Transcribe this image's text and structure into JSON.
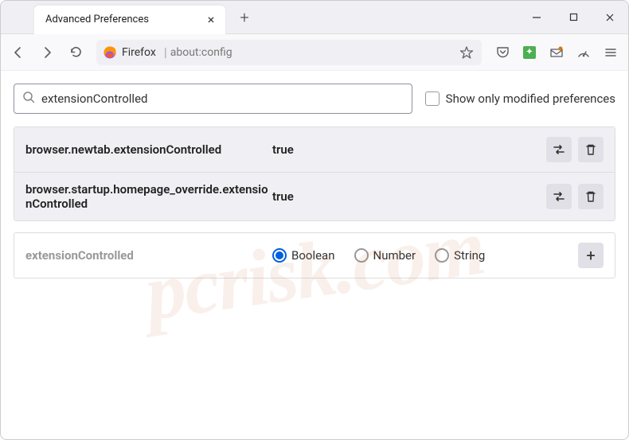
{
  "tab": {
    "title": "Advanced Preferences"
  },
  "addressbar": {
    "label": "Firefox",
    "url": "about:config"
  },
  "search": {
    "value": "extensionControlled",
    "checkbox_label": "Show only modified preferences"
  },
  "prefs": [
    {
      "name": "browser.newtab.extensionControlled",
      "value": "true"
    },
    {
      "name": "browser.startup.homepage_override.extensionControlled",
      "value": "true"
    }
  ],
  "new_pref": {
    "name": "extensionControlled",
    "types": [
      "Boolean",
      "Number",
      "String"
    ],
    "selected": 0
  },
  "watermark": "pcrisk.com"
}
